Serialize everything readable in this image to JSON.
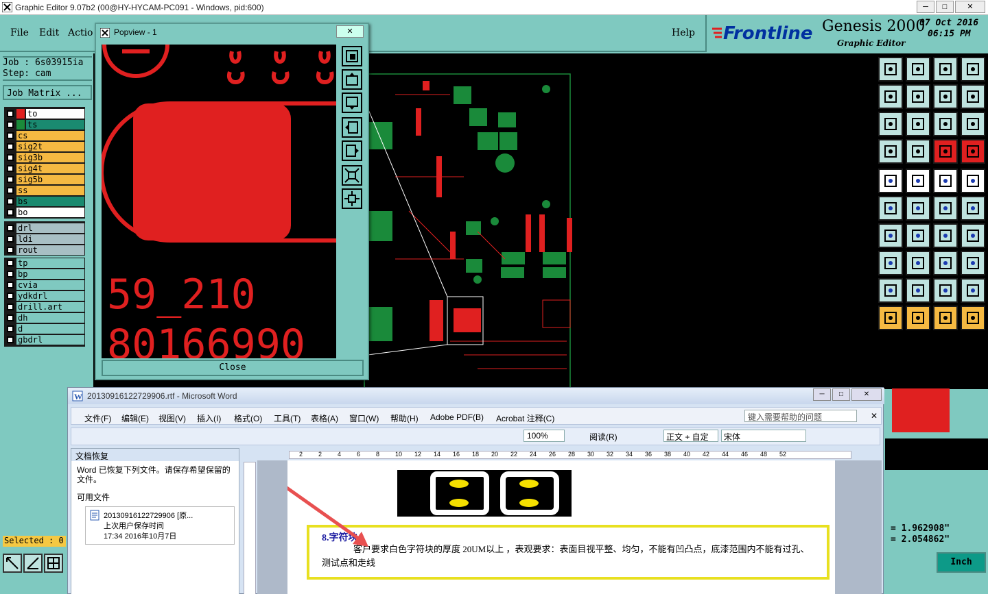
{
  "window": {
    "title": "Graphic Editor 9.07b2 (00@HY-HYCAM-PC091 - Windows, pid:600)"
  },
  "menu": {
    "file": "File",
    "edit": "Edit",
    "action": "Actio",
    "help": "Help"
  },
  "brand": {
    "logo": "Frontline",
    "product": "Genesis 2000",
    "subtitle": "Graphic Editor",
    "date": "07 Oct 2016",
    "time": "06:15 PM"
  },
  "job": {
    "job_label": "Job : 6s03915ia",
    "step_label": "Step: cam",
    "matrix_button": "Job Matrix ..."
  },
  "layers": [
    {
      "name": "to",
      "color": "#ffffff"
    },
    {
      "name": "ts",
      "color": "#1a8a70"
    },
    {
      "name": "cs",
      "color": "#f5b942"
    },
    {
      "name": "sig2t",
      "color": "#f5b942"
    },
    {
      "name": "sig3b",
      "color": "#f5b942"
    },
    {
      "name": "sig4t",
      "color": "#f5b942"
    },
    {
      "name": "sig5b",
      "color": "#f5b942"
    },
    {
      "name": "ss",
      "color": "#f5b942"
    },
    {
      "name": "bs",
      "color": "#1a8a70"
    },
    {
      "name": "bo",
      "color": "#ffffff"
    }
  ],
  "drill_layers": [
    {
      "name": "drl"
    },
    {
      "name": "ldi"
    },
    {
      "name": "rout"
    }
  ],
  "misc_layers": [
    {
      "name": "tp"
    },
    {
      "name": "bp"
    },
    {
      "name": "cvia"
    },
    {
      "name": "ydkdrl"
    },
    {
      "name": "drill.art"
    },
    {
      "name": "dh"
    },
    {
      "name": "d"
    },
    {
      "name": "gbdrl"
    }
  ],
  "status": {
    "selected": "Selected : 0",
    "x": "= 1.962908\"",
    "y": "= 2.054862\"",
    "units": "Inch"
  },
  "popview": {
    "title": "Popview - 1",
    "text1": "59_210",
    "text2": "80166990",
    "close": "Close"
  },
  "word": {
    "title": "20130916122729906.rtf - Microsoft Word",
    "menus": [
      "文件(F)",
      "编辑(E)",
      "视图(V)",
      "插入(I)",
      "格式(O)",
      "工具(T)",
      "表格(A)",
      "窗口(W)",
      "帮助(H)",
      "Adobe PDF(B)",
      "Acrobat 注释(C)"
    ],
    "help_placeholder": "键入需要帮助的问题",
    "zoom": "100%",
    "read": "阅读(R)",
    "style": "正文 + 自定",
    "font": "宋体",
    "recovery_title": "文档恢复",
    "recovery_text": "Word 已恢复下列文件。请保存希望保留的文件。",
    "available": "可用文件",
    "file_name": "20130916122729906 [原...",
    "file_sub": "上次用户保存时间",
    "file_time": "17:34 2016年10月7日",
    "heading": "8.字符块：",
    "body": "客户要求白色字符块的厚度 20UM以上 ，表观要求：表面目视平整、均匀，不能有凹凸点，底漆范围内不能有过孔、测试点和走线",
    "ruler": [
      "2",
      "2",
      "4",
      "6",
      "8",
      "10",
      "12",
      "14",
      "16",
      "18",
      "20",
      "22",
      "24",
      "26",
      "28",
      "30",
      "32",
      "34",
      "36",
      "38",
      "40",
      "42",
      "44",
      "46",
      "48",
      "52"
    ]
  }
}
